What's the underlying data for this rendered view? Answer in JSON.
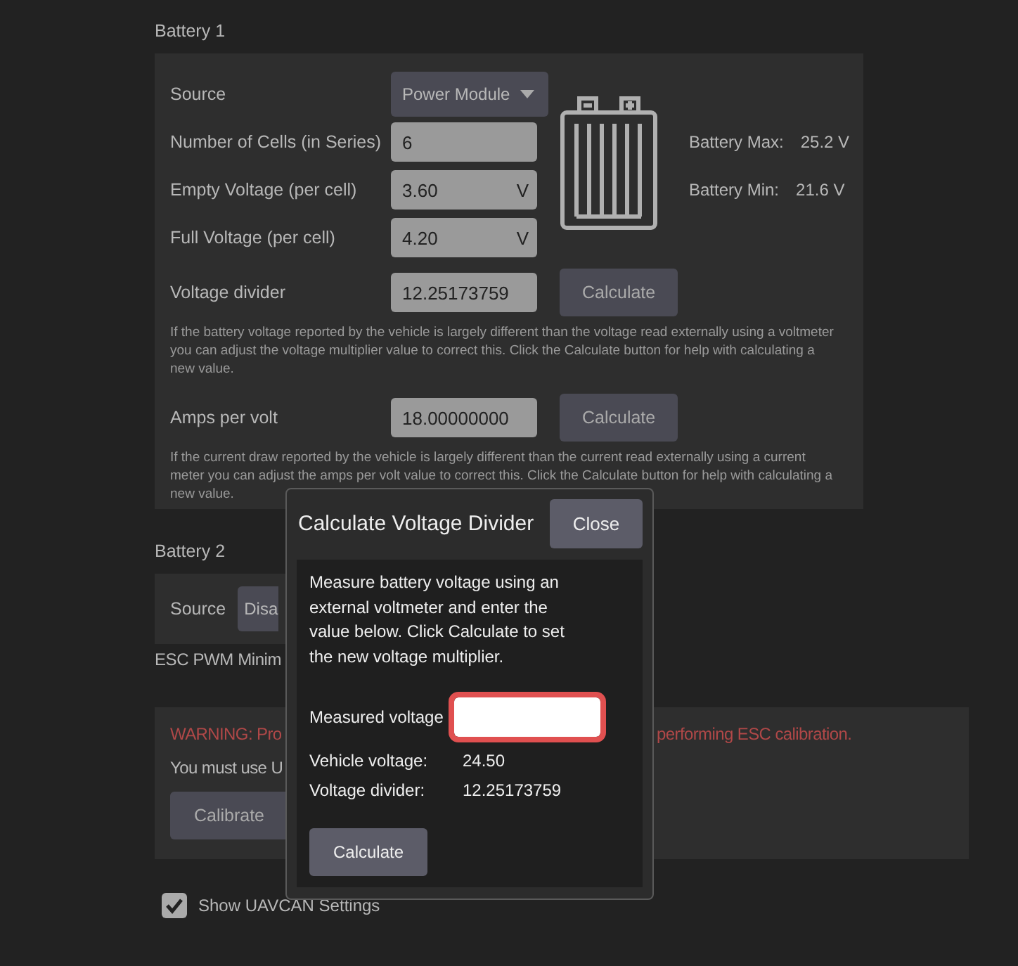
{
  "battery_1": {
    "title": "Battery 1",
    "source": {
      "label": "Source",
      "value": "Power Module"
    },
    "fields": [
      {
        "label": "Number of Cells (in Series)",
        "value": "6"
      },
      {
        "label": "Empty Voltage (per cell)",
        "value": "3.60",
        "unit": "V"
      },
      {
        "label": "Full Voltage (per cell)",
        "value": "4.20",
        "unit": "V"
      }
    ],
    "stats": [
      {
        "label": "Battery Max:",
        "value": "25.2 V"
      },
      {
        "label": "Battery Min:",
        "value": "21.6 V"
      }
    ],
    "calibrations": [
      {
        "label": "Voltage divider",
        "value": "12.25173759",
        "button": "Calculate",
        "help": "If the battery voltage reported by the vehicle is largely different than the voltage read externally using a voltmeter you can adjust the voltage multiplier value to correct this. Click the Calculate button for help with calculating a new value."
      },
      {
        "label": "Amps per volt",
        "value": "18.00000000",
        "button": "Calculate",
        "help": "If the current draw reported by the vehicle is largely different than the current read externally using a current meter you can adjust the amps per volt value to correct this. Click the Calculate button for help with calculating a new value."
      }
    ]
  },
  "battery_2": {
    "title": "Battery 2",
    "source": {
      "label": "Source",
      "value": "Disa"
    }
  },
  "esc_pwm": {
    "title": "ESC PWM Minim",
    "warning_start": "WARNING: Pro",
    "warning_end": "performing ESC calibration.",
    "note": "You must use U",
    "button": "Calibrate"
  },
  "show_uavcan": {
    "label": "Show UAVCAN Settings",
    "checked": true
  },
  "dialog": {
    "title": "Calculate Voltage Divider",
    "close": "Close",
    "instructions": "Measure battery voltage using an external voltmeter and enter the value below. Click Calculate to set the new voltage multiplier.",
    "measured": {
      "label": "Measured voltage",
      "focused": true
    },
    "readings": [
      {
        "label": "Vehicle voltage:",
        "value": "24.50"
      },
      {
        "label": "Voltage divider:",
        "value": "12.25173759"
      }
    ],
    "button": "Calculate"
  }
}
